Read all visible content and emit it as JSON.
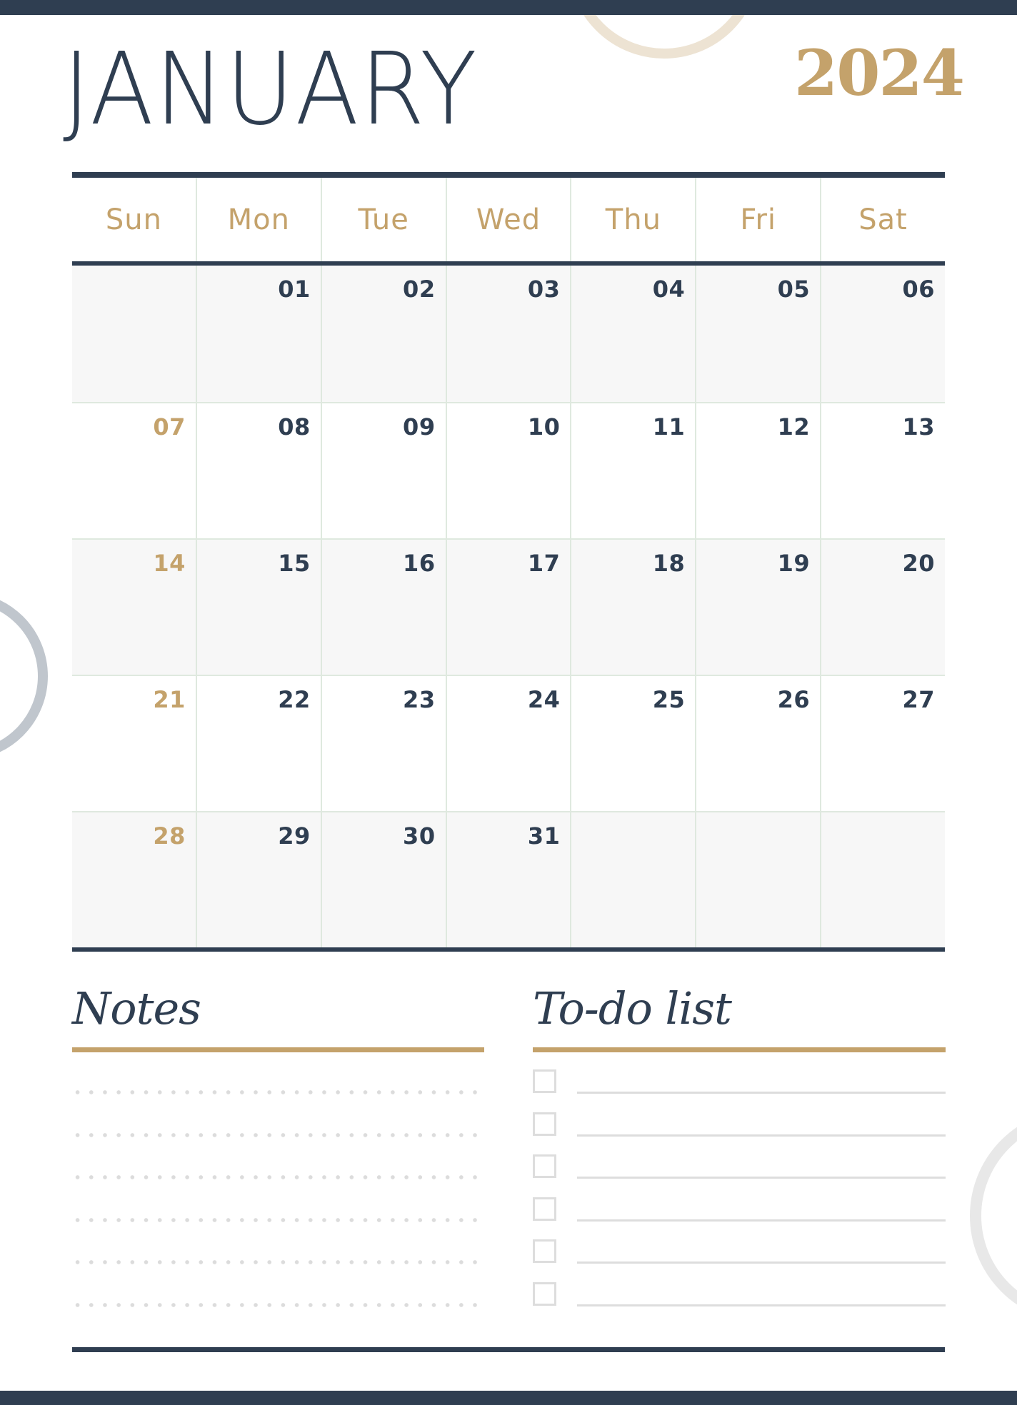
{
  "header": {
    "month": "JANUARY",
    "year": "2024"
  },
  "colors": {
    "navy": "#2f3e51",
    "gold": "#c4a26b",
    "grid_line": "#dfe9df",
    "shaded_row": "#f7f7f7"
  },
  "calendar": {
    "weekdays": [
      "Sun",
      "Mon",
      "Tue",
      "Wed",
      "Thu",
      "Fri",
      "Sat"
    ],
    "weeks": [
      [
        "",
        "01",
        "02",
        "03",
        "04",
        "05",
        "06"
      ],
      [
        "07",
        "08",
        "09",
        "10",
        "11",
        "12",
        "13"
      ],
      [
        "14",
        "15",
        "16",
        "17",
        "18",
        "19",
        "20"
      ],
      [
        "21",
        "22",
        "23",
        "24",
        "25",
        "26",
        "27"
      ],
      [
        "28",
        "29",
        "30",
        "31",
        "",
        "",
        ""
      ]
    ]
  },
  "notes": {
    "title": "Notes",
    "line_count": 6
  },
  "todo": {
    "title": "To-do list",
    "items": [
      {
        "checked": false,
        "text": ""
      },
      {
        "checked": false,
        "text": ""
      },
      {
        "checked": false,
        "text": ""
      },
      {
        "checked": false,
        "text": ""
      },
      {
        "checked": false,
        "text": ""
      },
      {
        "checked": false,
        "text": ""
      }
    ]
  }
}
